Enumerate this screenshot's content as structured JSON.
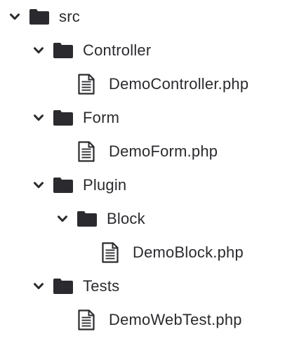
{
  "tree": {
    "src": {
      "label": "src",
      "icon": "folder-icon",
      "expanded": true
    },
    "controller": {
      "label": "Controller",
      "icon": "folder-icon",
      "expanded": true
    },
    "demo_controller": {
      "label": "DemoController.php",
      "icon": "file-icon"
    },
    "form": {
      "label": "Form",
      "icon": "folder-icon",
      "expanded": true
    },
    "demo_form": {
      "label": "DemoForm.php",
      "icon": "file-icon"
    },
    "plugin": {
      "label": "Plugin",
      "icon": "folder-icon",
      "expanded": true
    },
    "block": {
      "label": "Block",
      "icon": "folder-icon",
      "expanded": true
    },
    "demo_block": {
      "label": "DemoBlock.php",
      "icon": "file-icon"
    },
    "tests": {
      "label": "Tests",
      "icon": "folder-icon",
      "expanded": true
    },
    "demo_web_test": {
      "label": "DemoWebTest.php",
      "icon": "file-icon"
    }
  },
  "colors": {
    "icon": "#2b2b2f",
    "text": "#2b2b2f",
    "background": "#ffffff"
  }
}
